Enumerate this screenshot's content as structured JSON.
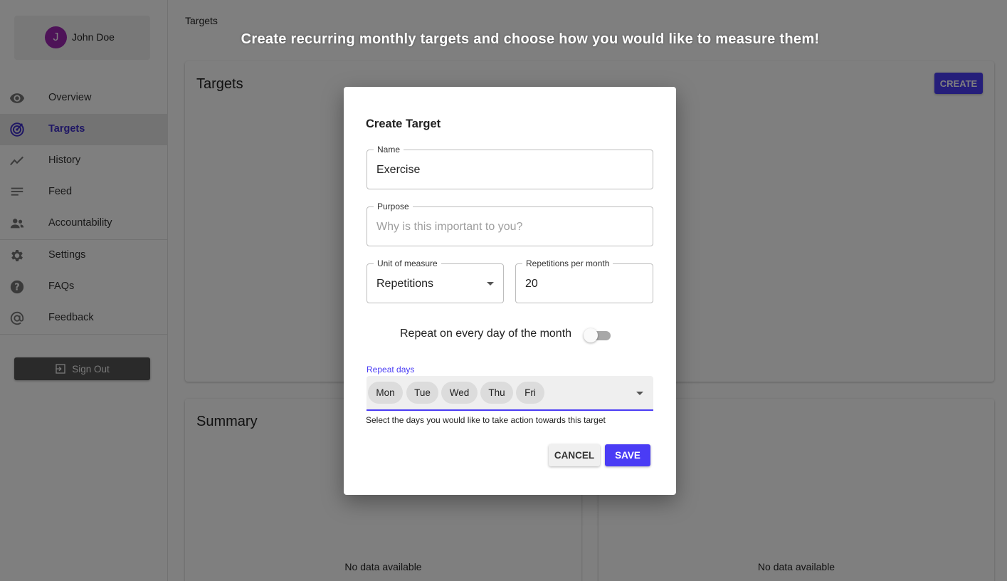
{
  "user": {
    "name": "John Doe",
    "initial": "J"
  },
  "sidebar": {
    "items": [
      {
        "label": "Overview",
        "icon": "eye-icon"
      },
      {
        "label": "Targets",
        "icon": "target-icon"
      },
      {
        "label": "History",
        "icon": "trend-line-icon"
      },
      {
        "label": "Feed",
        "icon": "feed-lines-icon"
      },
      {
        "label": "Accountability",
        "icon": "people-icon"
      },
      {
        "label": "Settings",
        "icon": "gear-icon"
      },
      {
        "label": "FAQs",
        "icon": "help-circle-icon"
      },
      {
        "label": "Feedback",
        "icon": "at-sign-icon"
      }
    ],
    "active": "Targets",
    "signout_label": "Sign Out"
  },
  "header": {
    "breadcrumb": "Targets",
    "banner": "Create recurring monthly targets and choose how you would like to measure them!"
  },
  "cards": {
    "targets_title": "Targets",
    "create_label": "CREATE",
    "summary_title": "Summary",
    "no_data": "No data available"
  },
  "dialog": {
    "title": "Create Target",
    "name": {
      "label": "Name",
      "value": "Exercise"
    },
    "purpose": {
      "label": "Purpose",
      "placeholder": "Why is this important to you?"
    },
    "unit": {
      "label": "Unit of measure",
      "value": "Repetitions"
    },
    "repetitions": {
      "label": "Repetitions per month",
      "value": "20"
    },
    "repeat_every_day": {
      "label": "Repeat on every day of the month",
      "enabled": false
    },
    "repeat_days": {
      "label": "Repeat days",
      "selected": [
        "Mon",
        "Tue",
        "Wed",
        "Thu",
        "Fri"
      ],
      "helper": "Select the days you would like to take action towards this target"
    },
    "cancel_label": "CANCEL",
    "save_label": "SAVE"
  },
  "colors": {
    "accent": "#4a3cf5",
    "active_nav": "#3f2fc9",
    "avatar": "#9c27b0"
  }
}
